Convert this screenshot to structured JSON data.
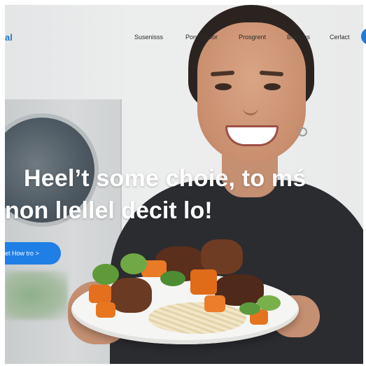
{
  "nav": {
    "logo": "al",
    "links": [
      "Susenisss",
      "Ponsdetoor",
      "Prosgrent",
      "Brançes",
      "Cerlact"
    ]
  },
  "hero": {
    "line1": "Heel’t some choie, to mś",
    "line2": "non lıellel decit lo!",
    "cta_label": "et How tro >"
  },
  "colors": {
    "accent": "#1f7fe6",
    "hero_text": "#ffffff",
    "shirt": "#2a2c30"
  }
}
